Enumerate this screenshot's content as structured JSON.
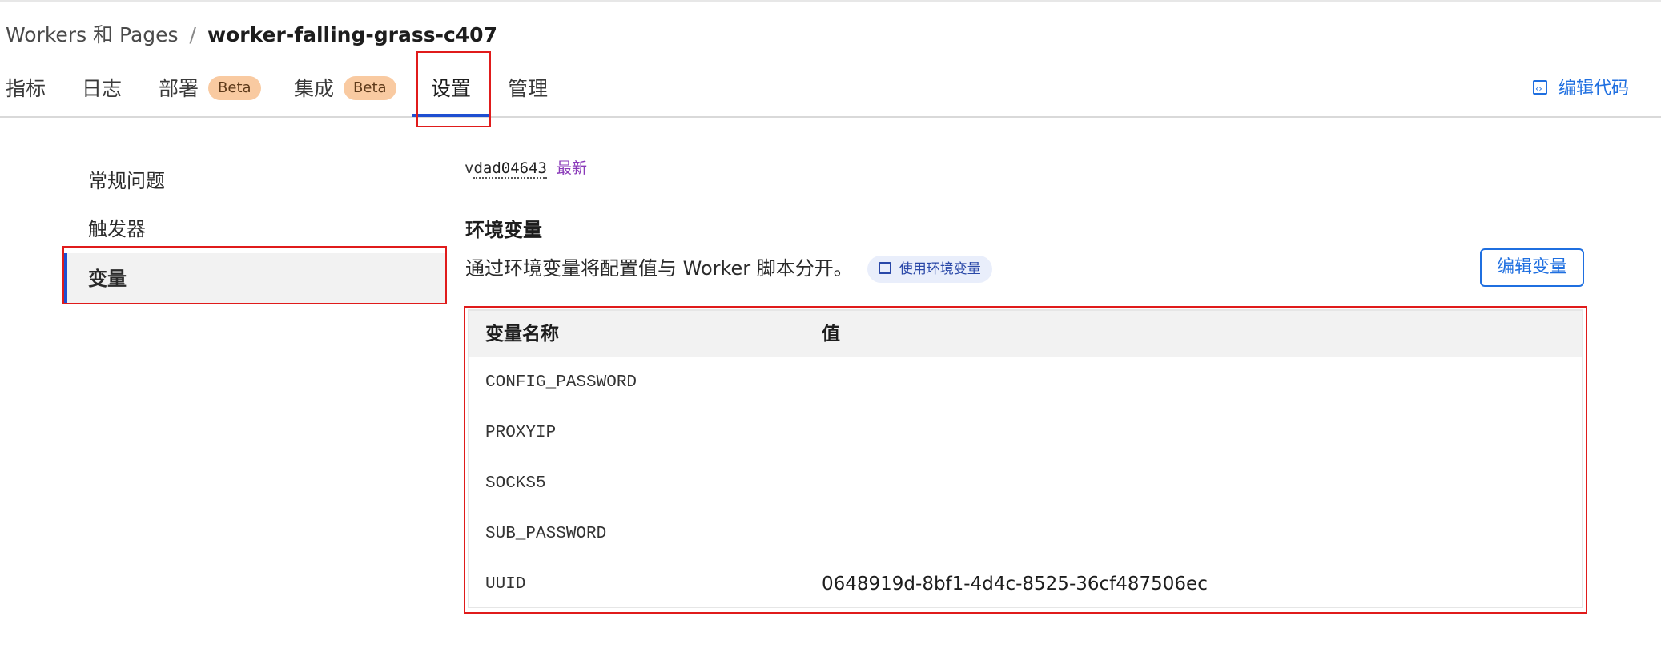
{
  "breadcrumb": {
    "parent": "Workers 和 Pages",
    "separator": "/",
    "current": "worker-falling-grass-c407"
  },
  "tabs": [
    {
      "label": "指标"
    },
    {
      "label": "日志"
    },
    {
      "label": "部署",
      "badge": "Beta"
    },
    {
      "label": "集成",
      "badge": "Beta"
    },
    {
      "label": "设置",
      "active": true
    },
    {
      "label": "管理"
    }
  ],
  "header_actions": {
    "edit_code": "编辑代码"
  },
  "sidebar": {
    "items": [
      {
        "label": "常规问题"
      },
      {
        "label": "触发器"
      },
      {
        "label": "变量",
        "active": true
      }
    ]
  },
  "version": {
    "prefix": "v",
    "id": "dad04643",
    "status": "最新"
  },
  "env_section": {
    "title": "环境变量",
    "description": "通过环境变量将配置值与 Worker 脚本分开。",
    "doc_link": "使用环境变量",
    "edit_button": "编辑变量"
  },
  "variables_table": {
    "headers": {
      "name": "变量名称",
      "value": "值"
    },
    "rows": [
      {
        "name": "CONFIG_PASSWORD",
        "value": ""
      },
      {
        "name": "PROXYIP",
        "value": ""
      },
      {
        "name": "SOCKS5",
        "value": ""
      },
      {
        "name": "SUB_PASSWORD",
        "value": ""
      },
      {
        "name": "UUID",
        "value": "0648919d-8bf1-4d4c-8525-36cf487506ec"
      }
    ]
  },
  "colors": {
    "accent": "#1f6fe0",
    "active_tab": "#1f4fd1",
    "highlight": "#e01b1b",
    "badge": "#f9caa1",
    "latest": "#8a3ab9"
  }
}
